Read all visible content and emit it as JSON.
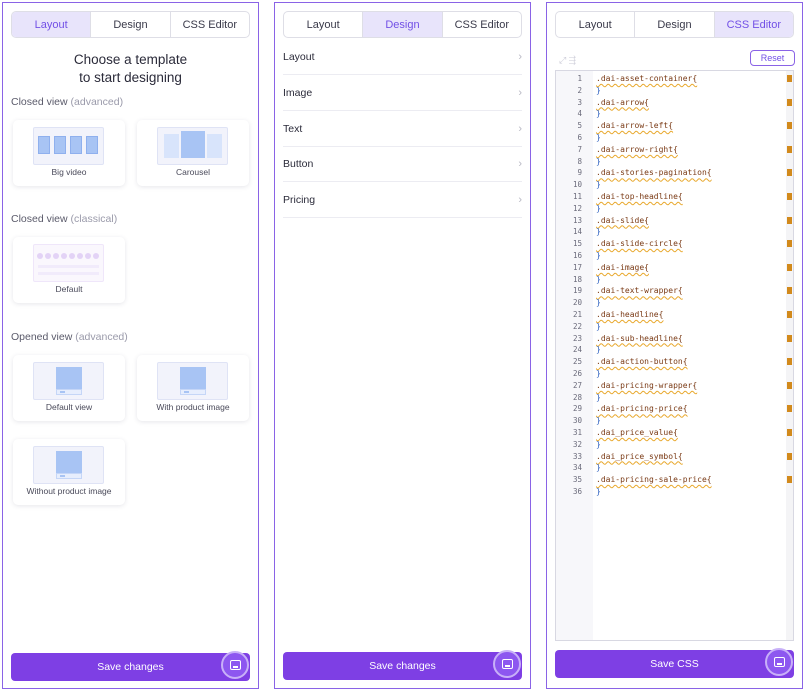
{
  "tabs": [
    "Layout",
    "Design",
    "CSS Editor"
  ],
  "layout_panel": {
    "heading_line1": "Choose a template",
    "heading_line2": "to start designing",
    "sections": [
      {
        "name": "Closed view",
        "qualifier": "(advanced)",
        "templates": [
          "Big video",
          "Carousel"
        ]
      },
      {
        "name": "Closed view",
        "qualifier": "(classical)",
        "templates": [
          "Default"
        ]
      },
      {
        "name": "Opened view",
        "qualifier": "(advanced)",
        "templates": [
          "Default view",
          "With product image",
          "Without product image"
        ]
      }
    ],
    "save_label": "Save changes"
  },
  "design_panel": {
    "rows": [
      "Layout",
      "Image",
      "Text",
      "Button",
      "Pricing"
    ],
    "chevron": "›",
    "save_label": "Save changes"
  },
  "css_panel": {
    "reset_label": "Reset",
    "tool_icons": "⤢ ⇶",
    "code_lines": [
      ".dai-asset-container{",
      "}",
      ".dai-arrow{",
      "}",
      ".dai-arrow-left{",
      "}",
      ".dai-arrow-right{",
      "}",
      ".dai-stories-pagination{",
      "}",
      ".dai-top-headline{",
      "}",
      ".dai-slide{",
      "}",
      ".dai-slide-circle{",
      "}",
      ".dai-image{",
      "}",
      ".dai-text-wrapper{",
      "}",
      ".dai-headline{",
      "}",
      ".dai-sub-headline{",
      "}",
      ".dai-action-button{",
      "}",
      ".dai-pricing-wrapper{",
      "}",
      ".dai-pricing-price{",
      "}",
      ".dai_price_value{",
      "}",
      ".dai_price_symbol{",
      "}",
      ".dai-pricing-sale-price{",
      "}"
    ],
    "save_label": "Save CSS"
  },
  "colors": {
    "accent": "#7e3fe4",
    "active_tab_bg": "#e8e4fb",
    "border": "#8a63e6"
  }
}
